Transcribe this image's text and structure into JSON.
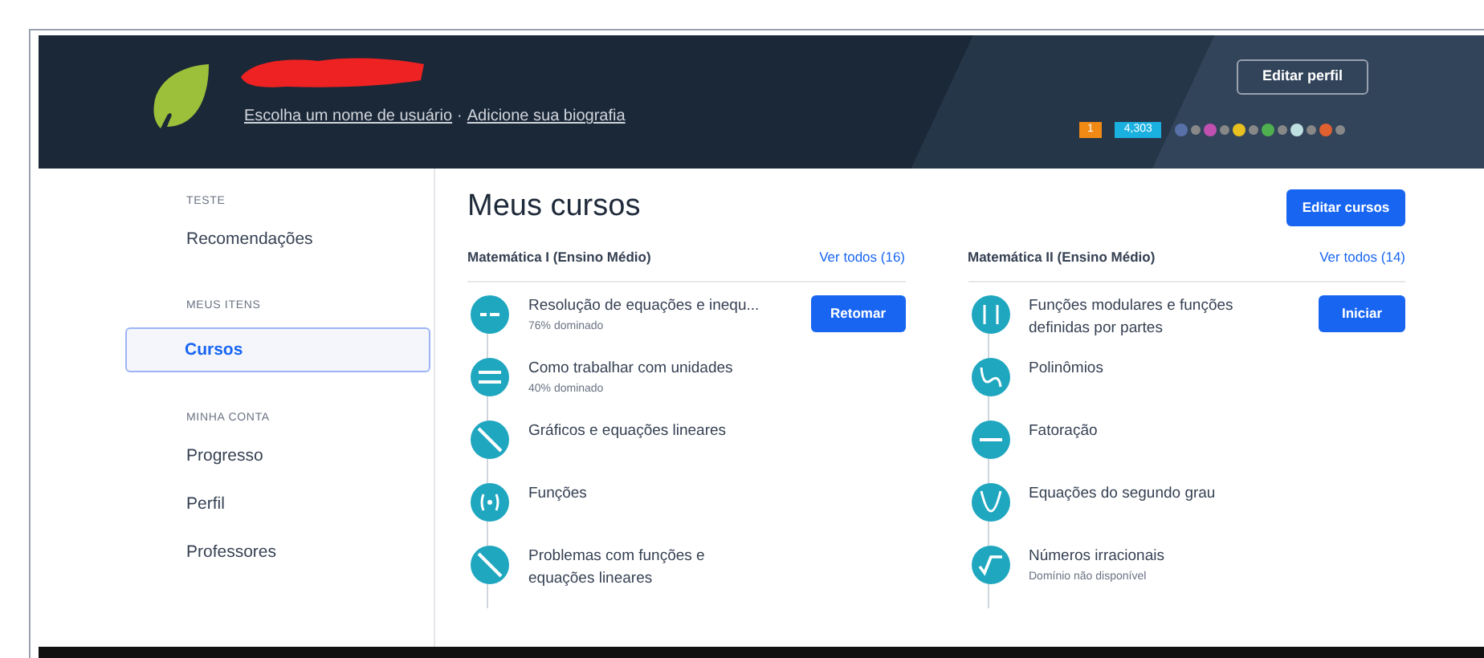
{
  "header": {
    "links": [
      "Escolha um nome de usuário",
      "Adicione sua biografia"
    ],
    "separator": "·",
    "edit_profile_button": "Editar perfil",
    "streak": "1",
    "points": "4,303"
  },
  "sidebar": {
    "sections": [
      {
        "heading": "TESTE",
        "items": [
          {
            "label": "Recomendações",
            "selected": false
          }
        ]
      },
      {
        "heading": "MEUS ITENS",
        "items": [
          {
            "label": "Cursos",
            "selected": true
          }
        ]
      },
      {
        "heading": "MINHA CONTA",
        "items": [
          {
            "label": "Progresso",
            "selected": false
          },
          {
            "label": "Perfil",
            "selected": false
          },
          {
            "label": "Professores",
            "selected": false
          }
        ]
      }
    ]
  },
  "main": {
    "title": "Meus cursos",
    "edit_courses_button": "Editar cursos",
    "courses": [
      {
        "title": "Matemática I (Ensino Médio)",
        "see_all": "Ver todos (16)",
        "action_button": "Retomar",
        "items": [
          {
            "kind": "equation",
            "title": "Resolução de equações e inequ...",
            "detail": "76% dominado"
          },
          {
            "kind": "units",
            "title": "Como trabalhar com unidades",
            "detail": "40% dominado"
          },
          {
            "kind": "line",
            "title": "Gráficos e equações lineares"
          },
          {
            "kind": "function",
            "title": "Funções"
          },
          {
            "kind": "line",
            "title": "Problemas com funções e\nequações lineares"
          }
        ]
      },
      {
        "title": "Matemática II (Ensino Médio)",
        "see_all": "Ver todos (14)",
        "action_button": "Iniciar",
        "items": [
          {
            "kind": "abs",
            "title": "Funções modulares e funções\ndefinidas por partes"
          },
          {
            "kind": "polynomial",
            "title": "Polinômios"
          },
          {
            "kind": "factor",
            "title": "Fatoração"
          },
          {
            "kind": "parabola",
            "title": "Equações do segundo grau"
          },
          {
            "kind": "sqrt",
            "title": "Números irracionais",
            "detail": "Domínio não disponível"
          }
        ]
      }
    ]
  }
}
